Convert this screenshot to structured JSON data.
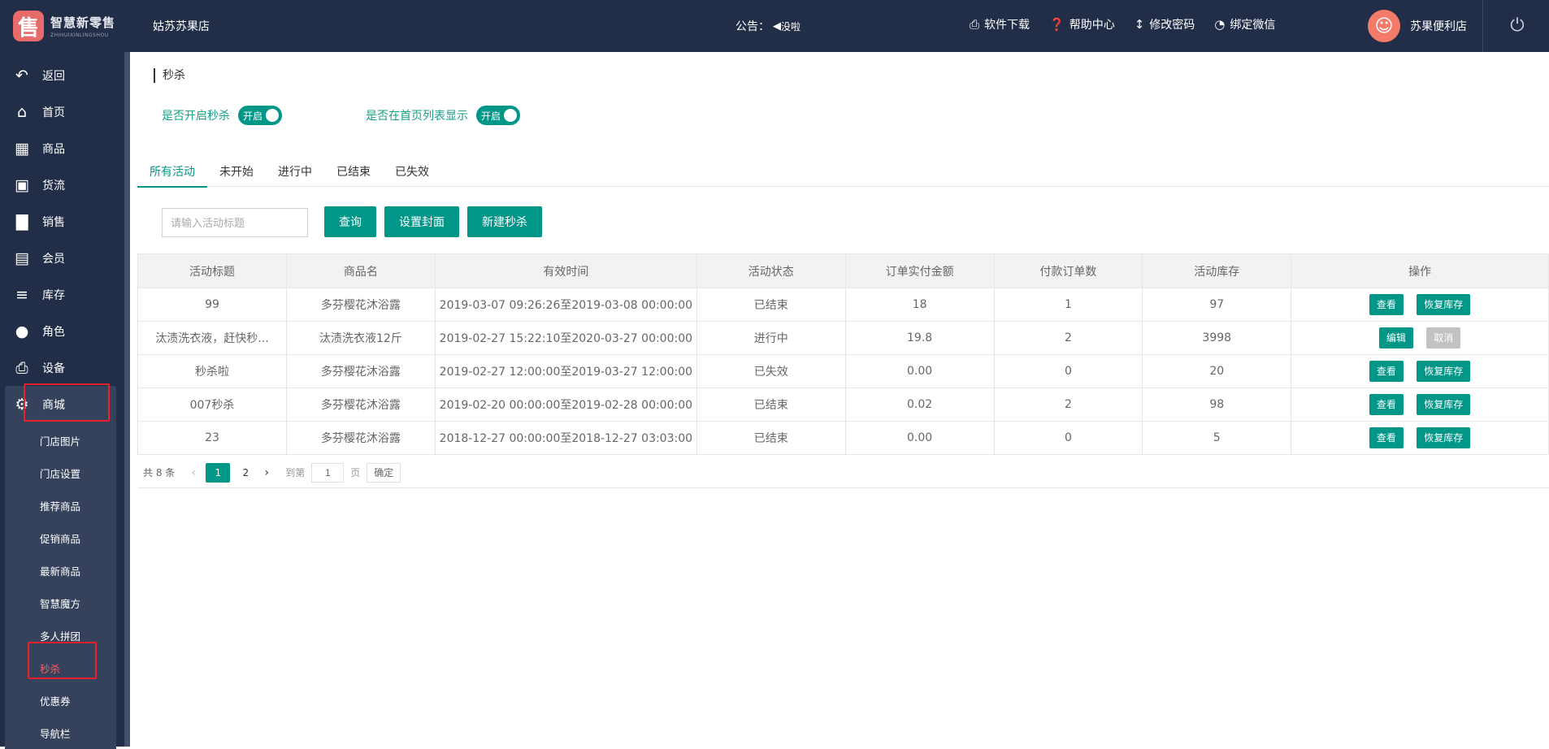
{
  "logo": {
    "cn": "智慧新零售",
    "en": "ZHIHUIXINLINGSHOU",
    "mark": "售"
  },
  "header": {
    "store_name": "姑苏苏果店",
    "notice_label": "公告：",
    "notice_text": "没啦",
    "links": [
      {
        "label": "软件下载",
        "icon": "printer-icon"
      },
      {
        "label": "帮助中心",
        "icon": "question-circle-icon"
      },
      {
        "label": "修改密码",
        "icon": "thermometer-icon"
      },
      {
        "label": "绑定微信",
        "icon": "wechat-icon"
      }
    ],
    "username": "苏果便利店"
  },
  "sidebar": {
    "items": [
      {
        "label": "返回",
        "icon": "back-arrow-icon"
      },
      {
        "label": "首页",
        "icon": "home-icon"
      },
      {
        "label": "商品",
        "icon": "grid-icon"
      },
      {
        "label": "货流",
        "icon": "truck-icon"
      },
      {
        "label": "销售",
        "icon": "bar-chart-icon"
      },
      {
        "label": "会员",
        "icon": "id-card-icon"
      },
      {
        "label": "库存",
        "icon": "database-icon"
      },
      {
        "label": "角色",
        "icon": "user-icon"
      },
      {
        "label": "设备",
        "icon": "printer-icon"
      },
      {
        "label": "商城",
        "icon": "gears-icon"
      }
    ],
    "submenu": [
      "门店图片",
      "门店设置",
      "推荐商品",
      "促销商品",
      "最新商品",
      "智慧魔方",
      "多人拼团",
      "秒杀",
      "优惠券",
      "导航栏"
    ],
    "current_sub": "秒杀"
  },
  "page": {
    "title": "秒杀",
    "switch1_label": "是否开启秒杀",
    "switch1_state": "开启",
    "switch2_label": "是否在首页列表显示",
    "switch2_state": "开启",
    "tabs": [
      "所有活动",
      "未开始",
      "进行中",
      "已结束",
      "已失效"
    ],
    "search_placeholder": "请输入活动标题",
    "btn_query": "查询",
    "btn_cover": "设置封面",
    "btn_new": "新建秒杀"
  },
  "table": {
    "headers": [
      "活动标题",
      "商品名",
      "有效时间",
      "活动状态",
      "订单实付金额",
      "付款订单数",
      "活动库存",
      "操作"
    ],
    "rows": [
      {
        "title": "99",
        "product": "多芬樱花沐浴露",
        "time": "2019-03-07 09:26:26至2019-03-08 00:00:00",
        "status": "已结束",
        "amount": "18",
        "orders": "1",
        "stock": "97",
        "actions": [
          "查看",
          "恢复库存"
        ]
      },
      {
        "title": "汰渍洗衣液，赶快秒...",
        "product": "汰渍洗衣液12斤",
        "time": "2019-02-27 15:22:10至2020-03-27 00:00:00",
        "status": "进行中",
        "amount": "19.8",
        "orders": "2",
        "stock": "3998",
        "actions": [
          "编辑",
          "取消"
        ]
      },
      {
        "title": "秒杀啦",
        "product": "多芬樱花沐浴露",
        "time": "2019-02-27 12:00:00至2019-03-27 12:00:00",
        "status": "已失效",
        "amount": "0.00",
        "orders": "0",
        "stock": "20",
        "actions": [
          "查看",
          "恢复库存"
        ]
      },
      {
        "title": "007秒杀",
        "product": "多芬樱花沐浴露",
        "time": "2019-02-20 00:00:00至2019-02-28 00:00:00",
        "status": "已结束",
        "amount": "0.02",
        "orders": "2",
        "stock": "98",
        "actions": [
          "查看",
          "恢复库存"
        ]
      },
      {
        "title": "23",
        "product": "多芬樱花沐浴露",
        "time": "2018-12-27 00:00:00至2018-12-27 03:03:00",
        "status": "已结束",
        "amount": "0.00",
        "orders": "0",
        "stock": "5",
        "actions": [
          "查看",
          "恢复库存"
        ]
      }
    ]
  },
  "pager": {
    "total": "共 8 条",
    "pages": [
      "1",
      "2"
    ],
    "current": "1",
    "goto_label": "到第",
    "goto_value": "1",
    "unit": "页",
    "confirm": "确定"
  }
}
